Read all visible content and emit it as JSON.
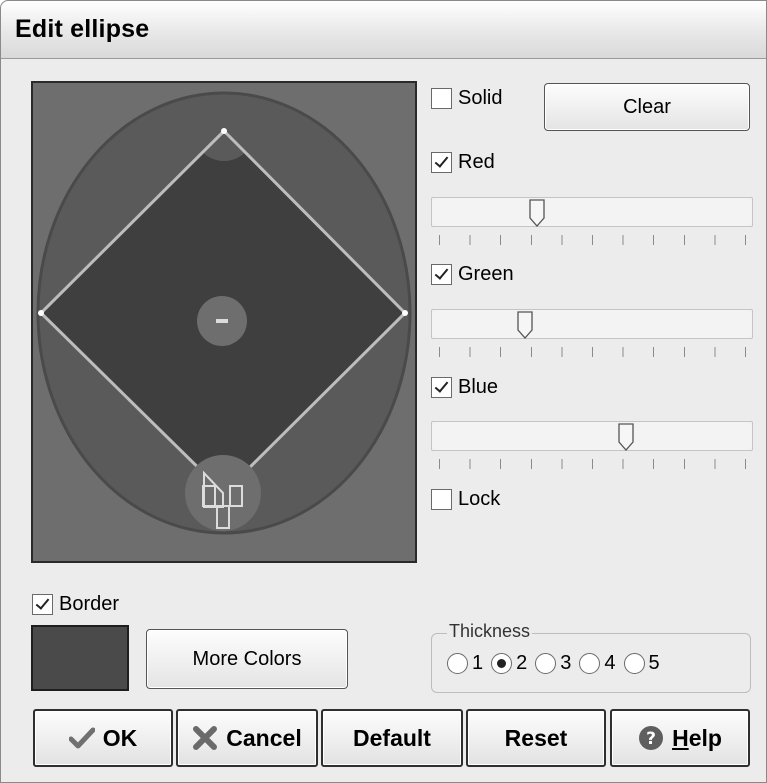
{
  "window": {
    "title": "Edit ellipse"
  },
  "preview": {
    "description_icon": "baseball-field-preview"
  },
  "options": {
    "solid": {
      "label": "Solid",
      "checked": false
    },
    "clear_label": "Clear",
    "red": {
      "label": "Red",
      "checked": true,
      "level": 0.32
    },
    "green": {
      "label": "Green",
      "checked": true,
      "level": 0.28
    },
    "blue": {
      "label": "Blue",
      "checked": true,
      "level": 0.61
    },
    "lock": {
      "label": "Lock",
      "checked": false
    }
  },
  "border": {
    "label": "Border",
    "checked": true,
    "color": "#4a4a4a",
    "more_colors_label": "More Colors"
  },
  "thickness": {
    "label": "Thickness",
    "options": [
      "1",
      "2",
      "3",
      "4",
      "5"
    ],
    "selected": "2"
  },
  "buttons": {
    "ok": "OK",
    "cancel": "Cancel",
    "default": "Default",
    "reset": "Reset",
    "help_first": "H",
    "help_rest": "elp"
  },
  "colors": {
    "field_outer": "#6e6e6e",
    "field_inner": "#5a5a5a",
    "infield": "#3f3f3f",
    "mound": "#6e6e6e",
    "lines": "#cfcfcf"
  }
}
